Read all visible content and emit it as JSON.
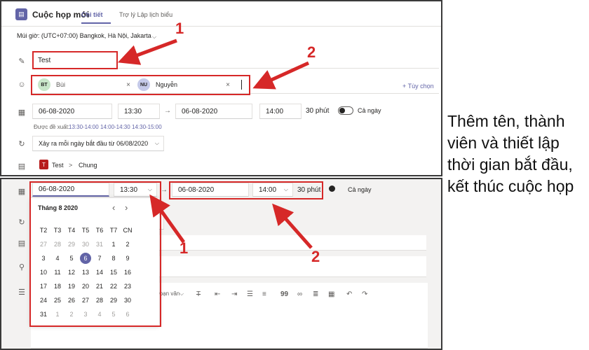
{
  "panel1": {
    "title": "Cuộc họp mới",
    "tabs": [
      "Chi tiết",
      "Trợ lý Lập lịch biểu"
    ],
    "timezone": "Múi giờ: (UTC+07:00) Bangkok, Hà Nội, Jakarta",
    "meeting_title": "Test",
    "attendees": [
      {
        "initials": "BT",
        "name": "Bùi"
      },
      {
        "initials": "NU",
        "name": "Nguyễn"
      }
    ],
    "optional_label": "+ Tùy chọn",
    "start_date": "06-08-2020",
    "start_time": "13:30",
    "end_date": "06-08-2020",
    "end_time": "14:00",
    "duration": "30 phút",
    "all_day": "Cả ngày",
    "suggested_label": "Được đề xuất:",
    "suggested_times": [
      "13:30-14:00",
      "14:00-14:30",
      "14:30-15:00"
    ],
    "recurrence": "Xảy ra mỗi ngày bắt đầu từ 06/08/2020",
    "channel_team_initial": "T",
    "channel_team": "Test",
    "channel_sep": ">",
    "channel_name": "Chung",
    "label_1": "1",
    "label_2": "2"
  },
  "panel2": {
    "start_date": "06-08-2020",
    "start_time": "13:30",
    "end_date": "06-08-2020",
    "end_time": "14:00",
    "duration": "30 phút",
    "all_day": "Cả ngày",
    "calendar": {
      "month": "Tháng 8 2020",
      "weekdays": [
        "T2",
        "T3",
        "T4",
        "T5",
        "T6",
        "T7",
        "CN"
      ],
      "days": [
        {
          "d": "27",
          "out": true
        },
        {
          "d": "28",
          "out": true
        },
        {
          "d": "29",
          "out": true
        },
        {
          "d": "30",
          "out": true
        },
        {
          "d": "31",
          "out": true
        },
        {
          "d": "1",
          "out": false
        },
        {
          "d": "2",
          "out": false
        },
        {
          "d": "3",
          "out": false
        },
        {
          "d": "4",
          "out": false
        },
        {
          "d": "5",
          "out": false
        },
        {
          "d": "6",
          "out": false,
          "sel": true
        },
        {
          "d": "7",
          "out": false
        },
        {
          "d": "8",
          "out": false
        },
        {
          "d": "9",
          "out": false
        },
        {
          "d": "10",
          "out": false
        },
        {
          "d": "11",
          "out": false
        },
        {
          "d": "12",
          "out": false
        },
        {
          "d": "13",
          "out": false
        },
        {
          "d": "14",
          "out": false
        },
        {
          "d": "15",
          "out": false
        },
        {
          "d": "16",
          "out": false
        },
        {
          "d": "17",
          "out": false
        },
        {
          "d": "18",
          "out": false
        },
        {
          "d": "19",
          "out": false
        },
        {
          "d": "20",
          "out": false
        },
        {
          "d": "21",
          "out": false
        },
        {
          "d": "22",
          "out": false
        },
        {
          "d": "23",
          "out": false
        },
        {
          "d": "24",
          "out": false
        },
        {
          "d": "25",
          "out": false
        },
        {
          "d": "26",
          "out": false
        },
        {
          "d": "27",
          "out": false
        },
        {
          "d": "28",
          "out": false
        },
        {
          "d": "29",
          "out": false
        },
        {
          "d": "30",
          "out": false
        },
        {
          "d": "31",
          "out": false
        },
        {
          "d": "1",
          "out": true
        },
        {
          "d": "2",
          "out": true
        },
        {
          "d": "3",
          "out": true
        },
        {
          "d": "4",
          "out": true
        },
        {
          "d": "5",
          "out": true
        },
        {
          "d": "6",
          "out": true
        }
      ]
    },
    "behind_time_fragment": "0",
    "behind_recur_fragment": "20",
    "paragraph_label": "Đoạn văn",
    "font_letter": "A",
    "clear_format": "T",
    "quote_mark": "99",
    "label_1": "1",
    "label_2": "2"
  },
  "caption": "Thêm tên, thành viên và thiết lập thời gian bắt đầu, kết thúc cuộc họp",
  "colors": {
    "accent": "#6264a7",
    "annotation_red": "#d62828"
  }
}
